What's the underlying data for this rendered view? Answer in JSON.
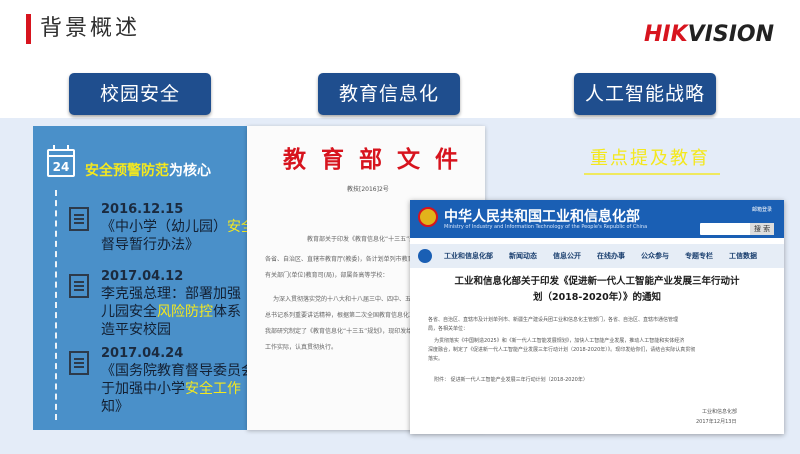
{
  "header": {
    "title": "背景概述",
    "logo_text_red": "HIK",
    "logo_text_dark": "VISION"
  },
  "pills": [
    "校园安全",
    "教育信息化",
    "人工智能战略"
  ],
  "ai": {
    "highlight": "重点提及教育"
  },
  "left_panel": {
    "calendar_day": "24",
    "title_highlight": "安全预警防范",
    "title_rest": "为核心",
    "events": [
      {
        "date": "2016.12.15",
        "line1_a": "《中小学（幼儿园）",
        "line1_hl": "安全",
        "line2": "督导暂行办法》"
      },
      {
        "date": "2017.04.12",
        "line1": "李克强总理：部署加强",
        "line2_a": "儿园安全",
        "line2_hl": "风险防控",
        "line2_b": "体系",
        "line3": "造平安校园"
      },
      {
        "date": "2017.04.24",
        "line1": "《国务院教育督导委员会",
        "line2_a": "于加强中小学",
        "line2_hl": "安全工作",
        "line3": "知》"
      }
    ]
  },
  "doc_paper": {
    "red_title": "教育部文件",
    "doc_number": "教技[2016]2号",
    "lines": [
      "教育部关于印发《教育信息化“十三五”规",
      "各省、自治区、直辖市教育厅(教委)，各计划单列市教育局，新",
      "有关部门(单位)教育司(局)，部属各高等学校：",
      "为深入贯彻落实党的十八大和十八届三中、四中、五中全会",
      "总书记系列重要讲话精神，根据第二次全国教育信息化工作电",
      "我部研究制定了《教育信息化“十三五”规划》，现印发给你们",
      "工作实际，认真贯彻执行。"
    ]
  },
  "miit": {
    "site_title": "中华人民共和国工业和信息化部",
    "site_subtitle": "Ministry of Industry and Information Technology of the People's Republic of China",
    "tools": "邮箱登录",
    "search_btn": "搜 索",
    "nav": [
      "工业和信息化部",
      "新闻动态",
      "信息公开",
      "在线办事",
      "公众参与",
      "专题专栏",
      "工信数据"
    ],
    "article_title_1": "工业和信息化部关于印发《促进新一代人工智能产业发展三年行动计",
    "article_title_2": "划（2018-2020年）》的通知",
    "body": [
      "各省、自治区、直辖市及计划单列市、新疆生产建设兵团工业和信息化主管部门，各省、自治区、直辖市通信管理",
      "局，各相关单位：",
      "为贯彻落实《中国制造2025》和《新一代人工智能发展规划》，加快人工智能产业发展，推动人工智能和实体经济",
      "深度融合，制定了《促进新一代人工智能产业发展三年行动计划（2018-2020年）》。现印发给你们，请结合实际认真贯彻",
      "落实。",
      "附件：  促进新一代人工智能产业发展三年行动计划（2018-2020年）"
    ],
    "signature_org": "工业和信息化部",
    "signature_date": "2017年12月13日"
  }
}
